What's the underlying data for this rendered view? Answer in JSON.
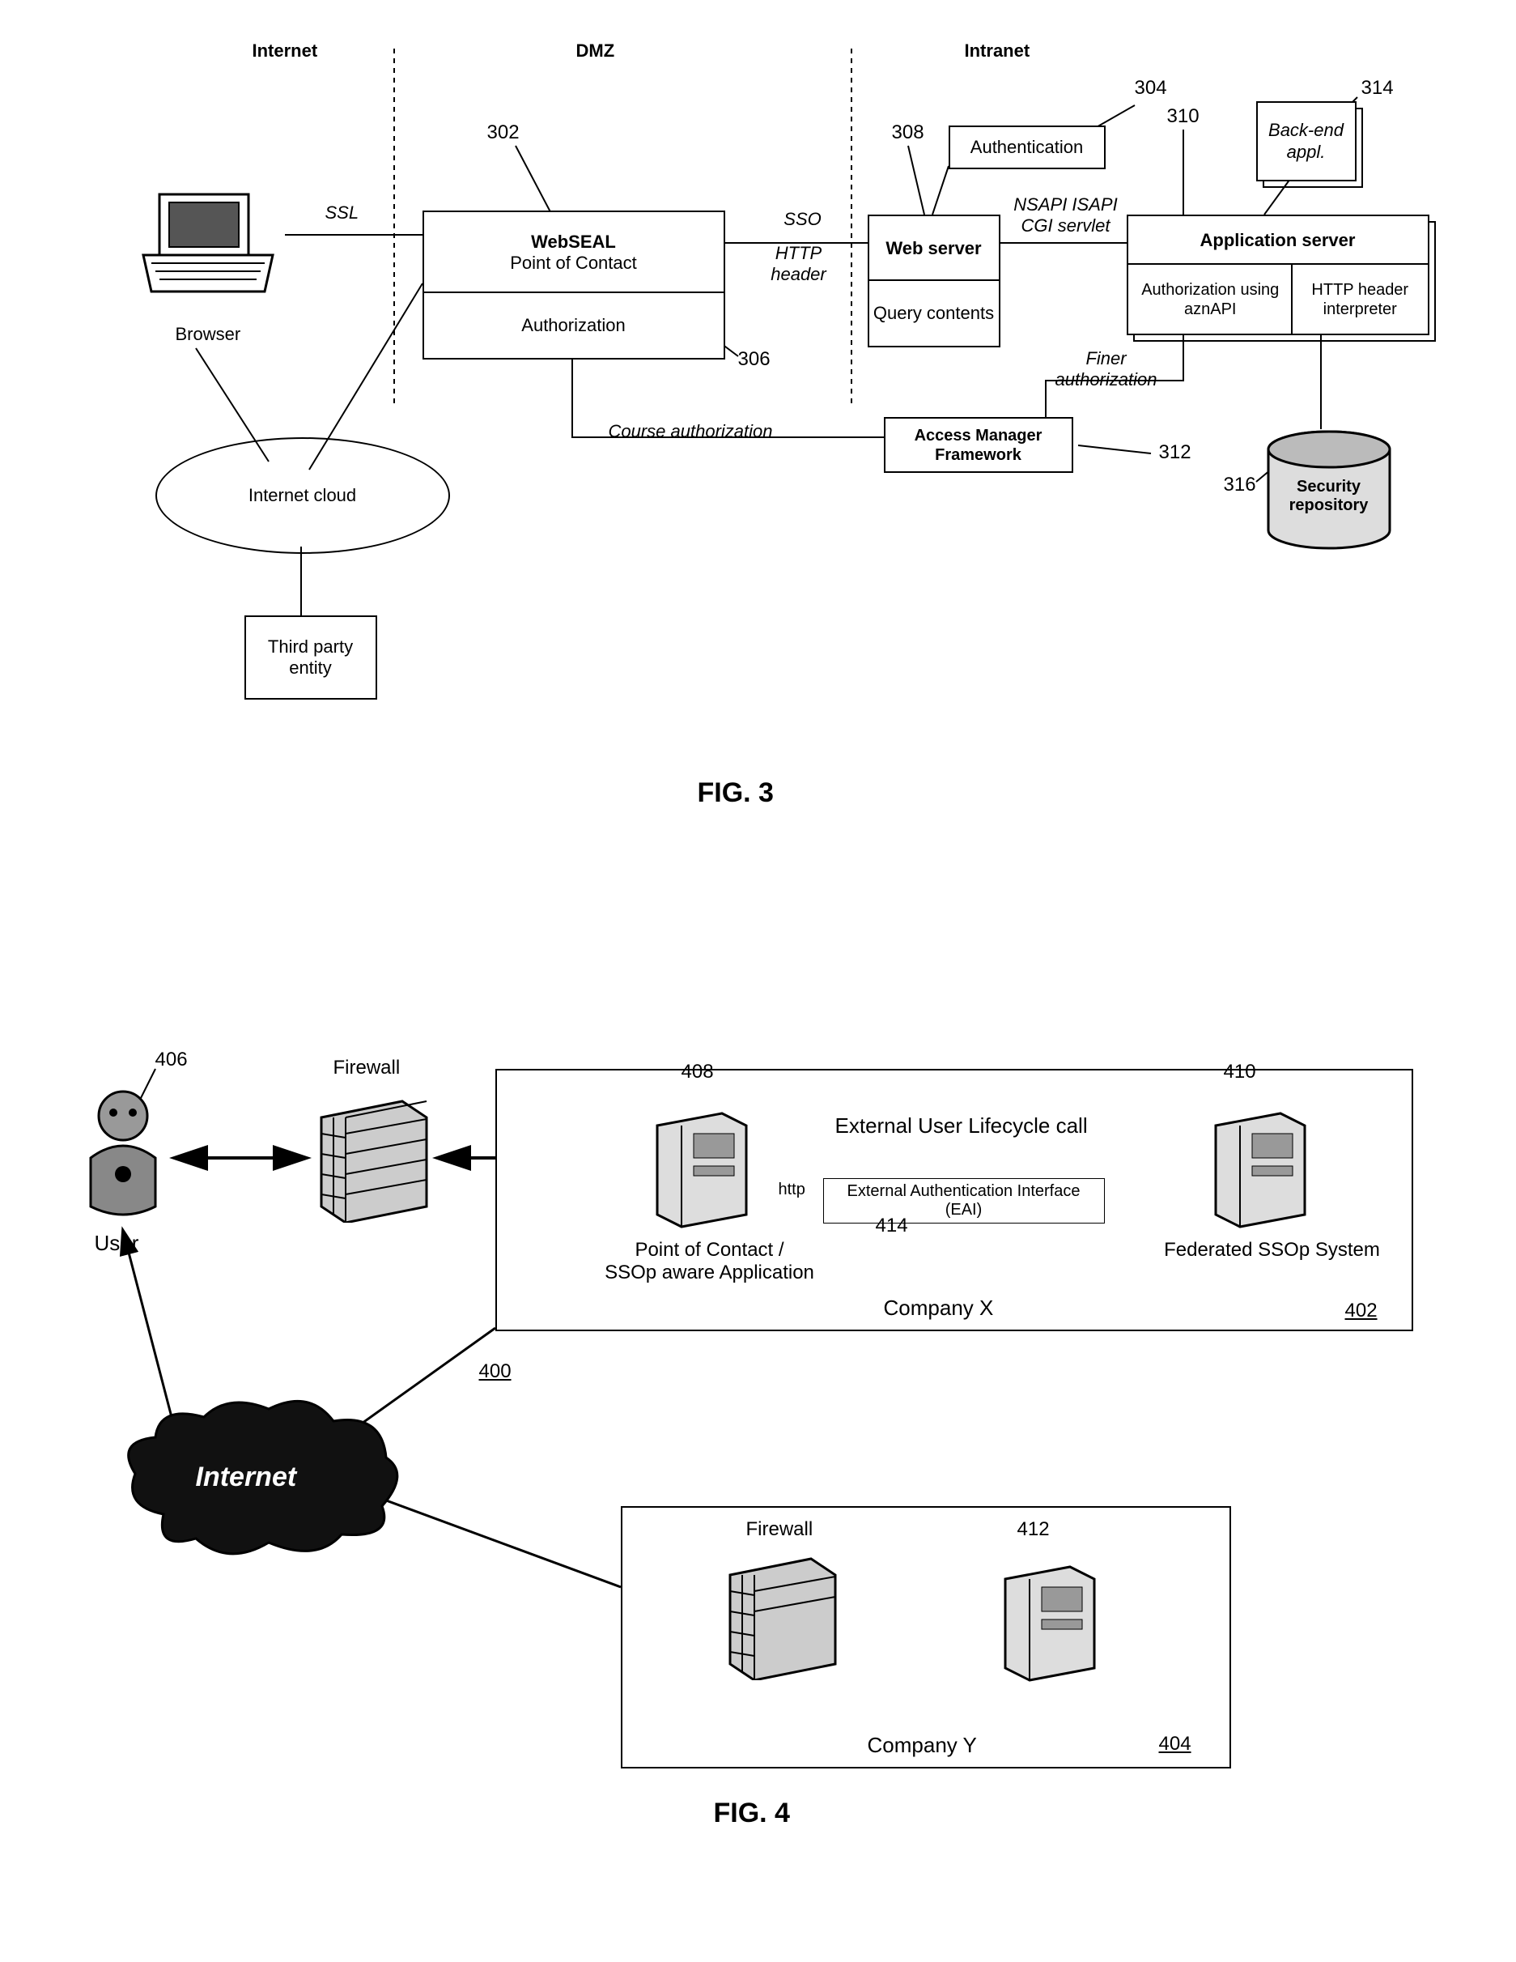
{
  "fig3": {
    "zones": {
      "internet": "Internet",
      "dmz": "DMZ",
      "intranet": "Intranet"
    },
    "browser_label": "Browser",
    "ssl": "SSL",
    "webseal_top": "WebSEAL",
    "webseal_sub": "Point of Contact",
    "authorization": "Authorization",
    "sso": "SSO",
    "http_header": "HTTP header",
    "web_server": "Web server",
    "query_contents": "Query contents",
    "authentication": "Authentication",
    "nsapi": "NSAPI ISAPI CGI servlet",
    "app_server": "Application server",
    "auth_azn": "Authorization using aznAPI",
    "http_header_interpreter": "HTTP header interpreter",
    "backend": "Back-end appl.",
    "finer_auth": "Finer authorization",
    "course_auth": "Course authorization",
    "access_mgr": "Access Manager Framework",
    "sec_repo": "Security repository",
    "internet_cloud": "Internet cloud",
    "third_party": "Third party entity",
    "refs": {
      "r302": "302",
      "r304": "304",
      "r306": "306",
      "r308": "308",
      "r310": "310",
      "r312": "312",
      "r314": "314",
      "r316": "316"
    },
    "caption": "FIG. 3"
  },
  "fig4": {
    "user": "User",
    "firewall": "Firewall",
    "firewall2": "Firewall",
    "internet": "Internet",
    "ext_call": "External User Lifecycle call",
    "http": "http",
    "eai": "External Authentication Interface (EAI)",
    "poc": "Point of Contact /\nSSOp aware Application",
    "fssop": "Federated SSOp System",
    "companyx": "Company X",
    "companyy": "Company Y",
    "refs": {
      "r400": "400",
      "r402": "402",
      "r404": "404",
      "r406": "406",
      "r408": "408",
      "r410": "410",
      "r412": "412",
      "r414": "414"
    },
    "caption": "FIG. 4"
  }
}
